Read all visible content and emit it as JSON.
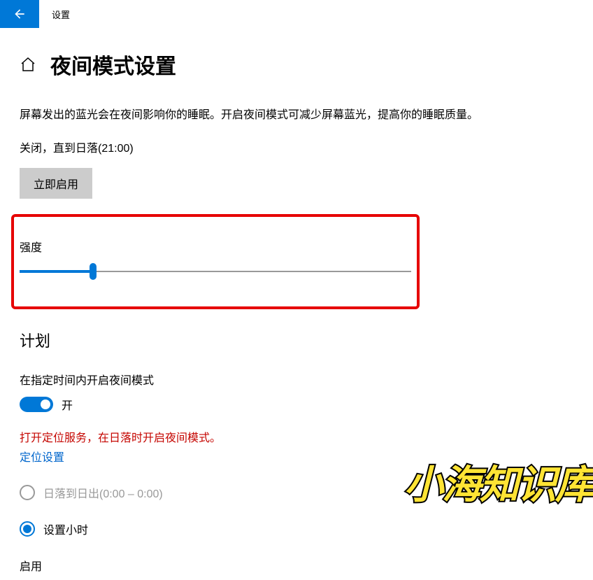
{
  "titlebar": {
    "label": "设置"
  },
  "page": {
    "title": "夜间模式设置",
    "description": "屏幕发出的蓝光会在夜间影响你的睡眠。开启夜间模式可减少屏幕蓝光，提高你的睡眠质量。",
    "status": "关闭，直到日落(21:00)",
    "action_button": "立即启用"
  },
  "strength": {
    "label": "强度"
  },
  "schedule": {
    "title": "计划",
    "enable_label": "在指定时间内开启夜间模式",
    "toggle_state": "开",
    "warning": "打开定位服务，在日落时开启夜间模式。",
    "link": "定位设置",
    "option_sunset": "日落到日出(0:00 – 0:00)",
    "option_hours": "设置小时",
    "enable_sub": "启用"
  },
  "watermark": "小海知识库"
}
